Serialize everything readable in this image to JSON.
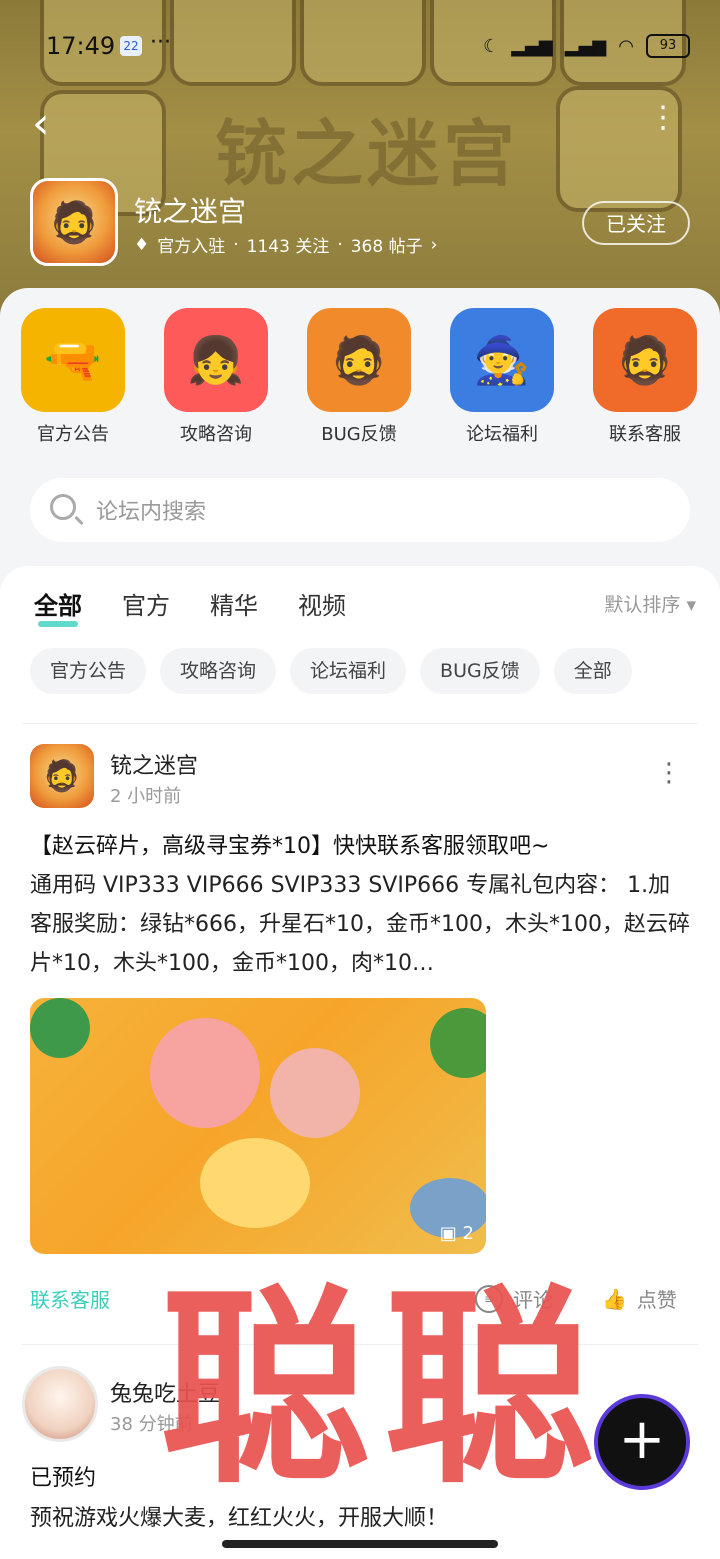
{
  "status_bar": {
    "time": "17:49",
    "calendar_day": "22",
    "dots": "···",
    "battery": "93"
  },
  "header": {
    "banner_text": "铳之迷宫",
    "game_name": "铳之迷宫",
    "official": "官方入驻",
    "followers": "1143 关注",
    "posts": "368 帖子",
    "follow_label": "已关注"
  },
  "quick_links": [
    {
      "label": "官方公告",
      "color": "#f5b400"
    },
    {
      "label": "攻略咨询",
      "color": "#ff5a5a"
    },
    {
      "label": "BUG反馈",
      "color": "#f08a2a"
    },
    {
      "label": "论坛福利",
      "color": "#3b7de0"
    },
    {
      "label": "联系客服",
      "color": "#f06a2a"
    }
  ],
  "search": {
    "placeholder": "论坛内搜索"
  },
  "tabs": [
    "全部",
    "官方",
    "精华",
    "视频"
  ],
  "sort_label": "默认排序",
  "chips": [
    "官方公告",
    "攻略咨询",
    "论坛福利",
    "BUG反馈",
    "全部"
  ],
  "post1": {
    "author": "铳之迷宫",
    "time": "2 小时前",
    "title": "【赵云碎片，高级寻宝券*10】快快联系客服领取吧~",
    "body": "通用码 VIP333 VIP666 SVIP333 SVIP666 专属礼包内容： 1.加客服奖励：绿钻*666，升星石*10，金币*100，木头*100，赵云碎片*10，木头*100，金币*100，肉*10…",
    "image_count": "2",
    "tag": "联系客服",
    "comment_label": "评论",
    "like_label": "点赞"
  },
  "post2": {
    "author": "兔兔吃土豆",
    "time": "38 分钟前",
    "title": "已预约",
    "body": "预祝游戏火爆大麦，红红火火，开服大顺！"
  },
  "watermark": "聪聪",
  "fab_label": "+"
}
